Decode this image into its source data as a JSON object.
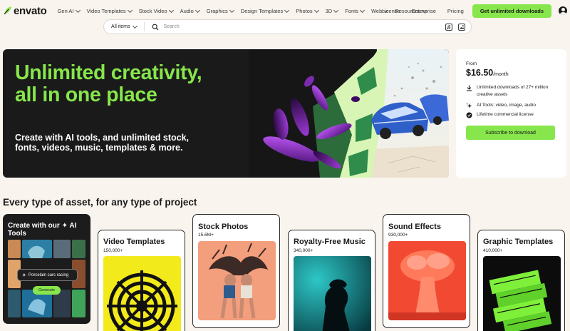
{
  "nav": {
    "logo": "envato",
    "items": [
      "Gen AI",
      "Video Templates",
      "Stock Video",
      "Audio",
      "Graphics",
      "Design Templates",
      "Photos",
      "3D",
      "Fonts",
      "Web",
      "Resources"
    ],
    "license": "License",
    "enterprise": "Enterprise",
    "pricing": "Pricing",
    "cta": "Get unlimited downloads"
  },
  "search": {
    "category": "All items",
    "placeholder": "Search"
  },
  "hero": {
    "title": "Unlimited creativity, all in one place",
    "subtitle": "Create with AI tools, and unlimited stock, fonts, videos, music, templates & more."
  },
  "pricing": {
    "from": "From",
    "price": "$16.50",
    "period": "/month",
    "features": [
      "Unlimited downloads of 27+ million creative assets",
      "AI Tools: video, image, audio",
      "Lifetime commercial license"
    ],
    "cta": "Subscribe to download"
  },
  "section": {
    "title": "Every type of asset, for any type of project"
  },
  "ai_card": {
    "title": "Create with our ✦ AI Tools",
    "prompt": "Porcelain cars racing",
    "button": "Generate"
  },
  "cards": [
    {
      "title": "Video Templates",
      "count": "150,000+"
    },
    {
      "title": "Stock Photos",
      "count": "15.6M+"
    },
    {
      "title": "Royalty-Free Music",
      "count": "340,000+"
    },
    {
      "title": "Sound Effects",
      "count": "930,000+"
    },
    {
      "title": "Graphic Templates",
      "count": "410,000+"
    }
  ],
  "colors": {
    "accent": "#87e64b",
    "background": "#f9f4ee",
    "dark": "#1a1a1a"
  }
}
